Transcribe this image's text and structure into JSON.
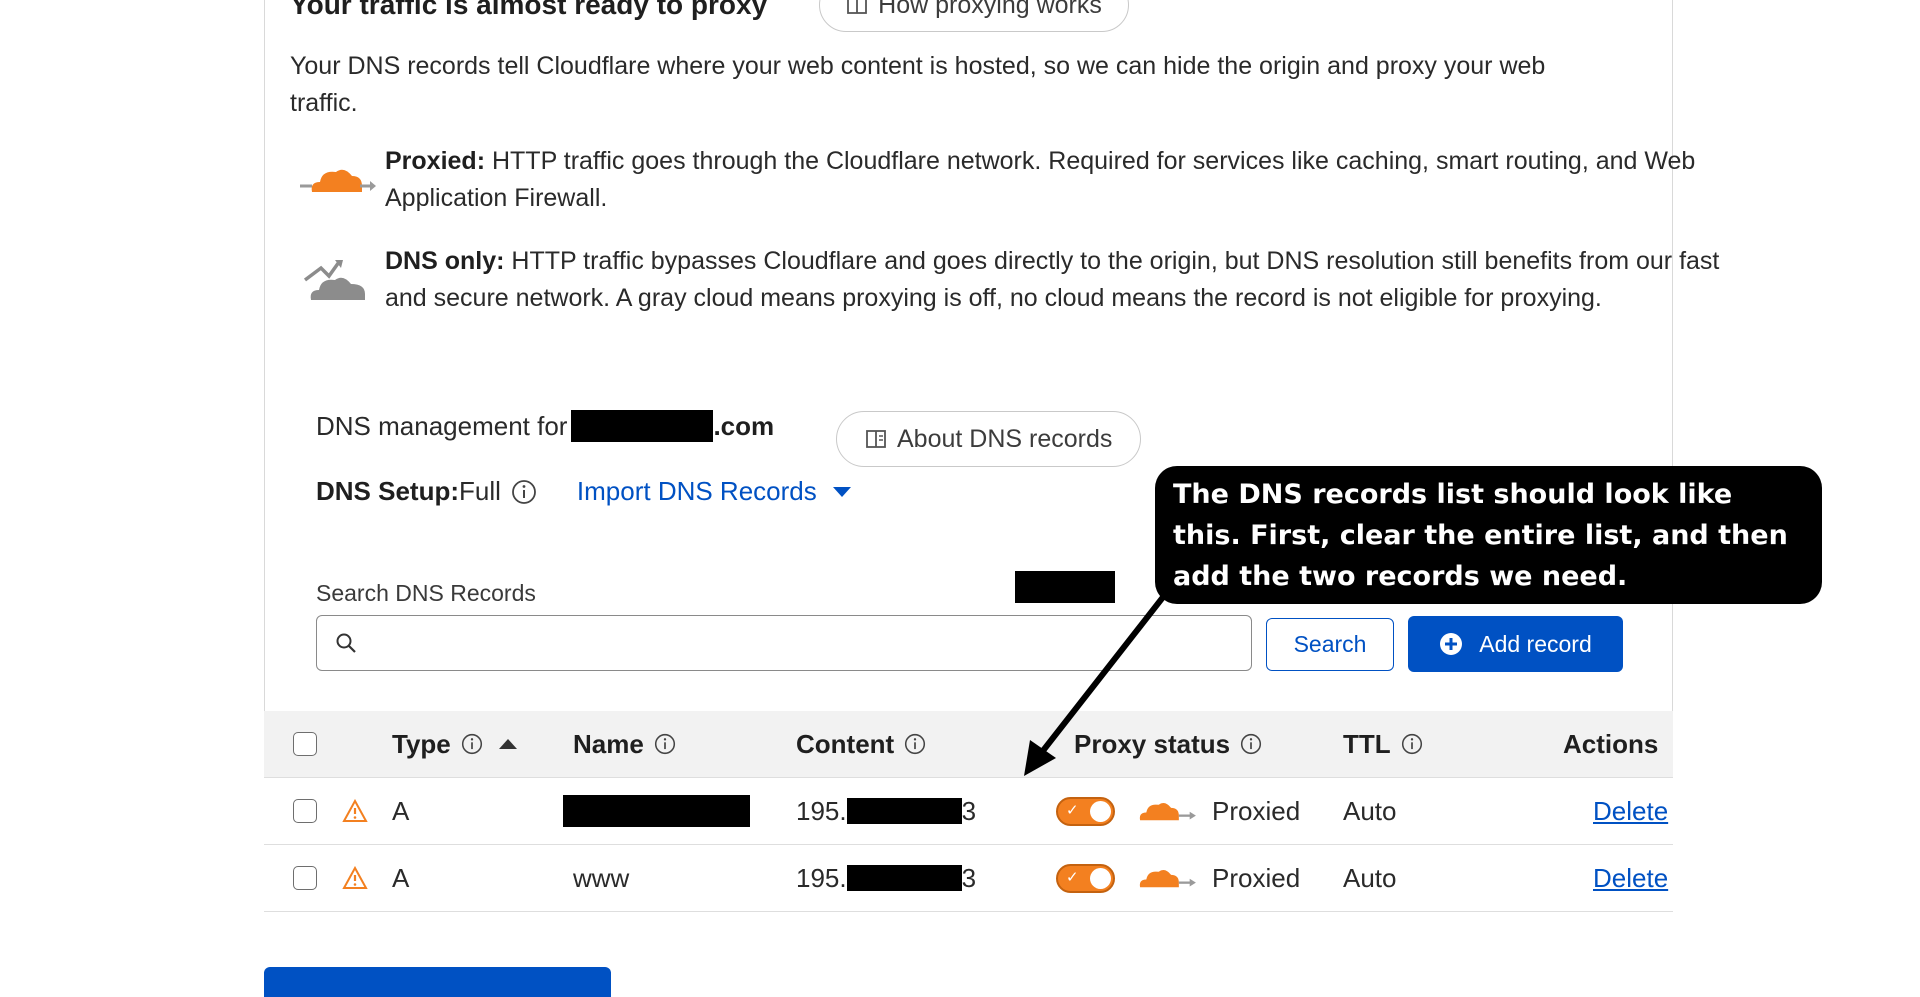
{
  "header": {
    "title": "Your traffic is almost ready to proxy",
    "how_label": "How proxying works"
  },
  "intro": "Your DNS records tell Cloudflare where your web content is hosted, so we can hide the origin and proxy your web traffic.",
  "legend": {
    "proxied_title": "Proxied:",
    "proxied_text": " HTTP traffic goes through the Cloudflare network. Required for services like caching, smart routing, and Web Application Firewall.",
    "dns_only_title": "DNS only:",
    "dns_only_text": " HTTP traffic bypasses Cloudflare and goes directly to the origin, but DNS resolution still benefits from our fast and secure network. A gray cloud means proxying is off, no cloud means the record is not eligible for proxying."
  },
  "management": {
    "prefix": "DNS management for ",
    "suffix": ".com",
    "about_label": "About DNS records"
  },
  "setup": {
    "label": "DNS Setup:",
    "value": " Full",
    "import_label": "Import DNS Records"
  },
  "search": {
    "label": "Search DNS Records",
    "value": "",
    "placeholder": "",
    "button_label": "Search",
    "add_label": "Add record"
  },
  "table": {
    "columns": {
      "type": "Type",
      "name": "Name",
      "content": "Content",
      "proxy": "Proxy status",
      "ttl": "TTL",
      "actions": "Actions"
    },
    "rows": [
      {
        "type": "A",
        "name": "",
        "content_prefix": "195.",
        "content_suffix": "3",
        "proxy": "Proxied",
        "ttl": "Auto",
        "action": "Delete"
      },
      {
        "type": "A",
        "name": "www",
        "content_prefix": "195.",
        "content_suffix": "3",
        "proxy": "Proxied",
        "ttl": "Auto",
        "action": "Delete"
      }
    ]
  },
  "callout": "The DNS records list should look like this. First, clear the entire list, and then add the two records we need.",
  "colors": {
    "accent": "#0051c3",
    "proxied_orange": "#f38020",
    "warning": "#f38020",
    "gray_cloud": "#8c8c8c"
  },
  "icons": [
    "book-icon",
    "orange-cloud-icon",
    "gray-cloud-icon",
    "info-icon",
    "caret-down-icon",
    "search-icon",
    "plus-circle-icon",
    "sort-asc-icon",
    "warning-icon",
    "toggle-icon"
  ]
}
